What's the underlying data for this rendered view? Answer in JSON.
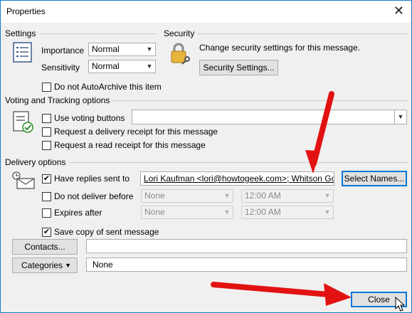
{
  "window": {
    "title": "Properties",
    "close_glyph": "✕"
  },
  "settings": {
    "header": "Settings",
    "importance_label": "Importance",
    "importance_value": "Normal",
    "sensitivity_label": "Sensitivity",
    "sensitivity_value": "Normal",
    "autoarchive_label": "Do not AutoArchive this item",
    "autoarchive_checked": false
  },
  "security": {
    "header": "Security",
    "description": "Change security settings for this message.",
    "button_label": "Security Settings..."
  },
  "voting": {
    "header": "Voting and Tracking options",
    "use_voting_label": "Use voting buttons",
    "use_voting_checked": false,
    "voting_value": "",
    "delivery_receipt_label": "Request a delivery receipt for this message",
    "delivery_receipt_checked": false,
    "read_receipt_label": "Request a read receipt for this message",
    "read_receipt_checked": false
  },
  "delivery": {
    "header": "Delivery options",
    "replies_label": "Have replies sent to",
    "replies_checked": true,
    "replies_value": "Lori Kaufman <lori@howtogeek.com>; Whitson Gordon",
    "select_names_label": "Select Names...",
    "do_not_deliver_label": "Do not deliver before",
    "do_not_deliver_checked": false,
    "do_not_deliver_date": "None",
    "do_not_deliver_time": "12:00 AM",
    "expires_label": "Expires after",
    "expires_checked": false,
    "expires_date": "None",
    "expires_time": "12:00 AM",
    "save_copy_label": "Save copy of sent message",
    "save_copy_checked": true
  },
  "contacts": {
    "button_label": "Contacts...",
    "value": ""
  },
  "categories": {
    "button_label": "Categories",
    "value": "None"
  },
  "footer": {
    "close_label": "Close"
  },
  "colors": {
    "accent": "#1979ca",
    "annotation_arrow": "#e21212",
    "focus": "#0078d7"
  }
}
